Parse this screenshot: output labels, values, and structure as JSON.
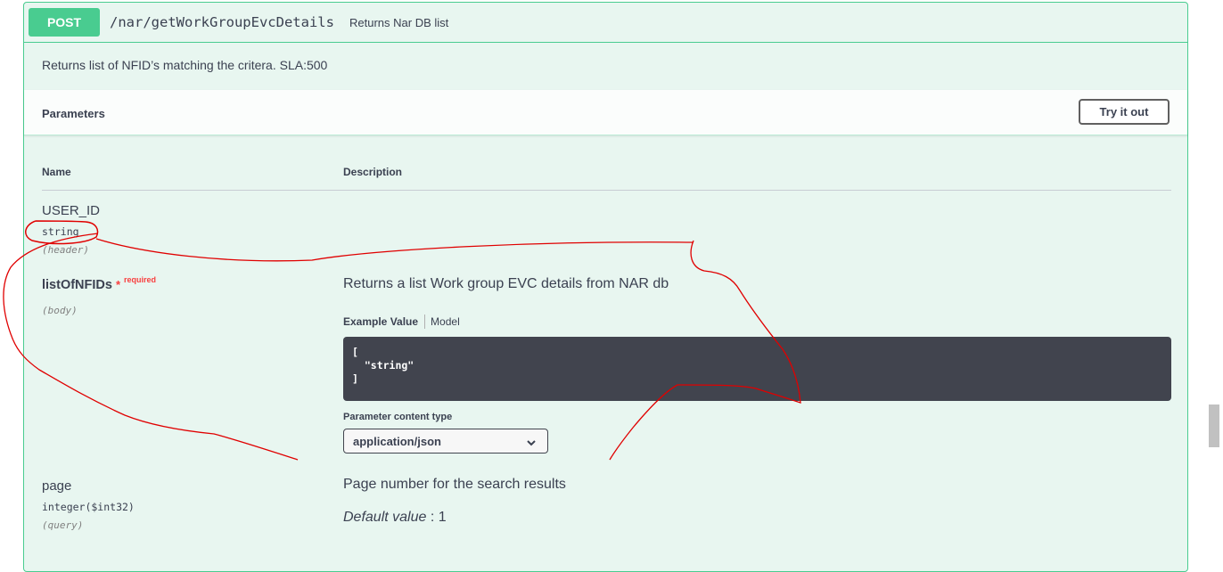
{
  "operation": {
    "method": "POST",
    "path": "/nar/getWorkGroupEvcDetails",
    "summary": "Returns Nar DB list",
    "description": "Returns list of NFID’s matching the critera. SLA:500"
  },
  "parameters_section": {
    "title": "Parameters",
    "try_button_label": "Try it out",
    "columns": {
      "name": "Name",
      "description": "Description"
    }
  },
  "params": [
    {
      "name": "USER_ID",
      "type": "string",
      "in": "(header)",
      "description": ""
    },
    {
      "name": "listOfNFIDs",
      "required_star": "*",
      "required_label": "required",
      "in": "(body)",
      "description": "Returns a list Work group EVC details from NAR db",
      "tabs": {
        "active": "Example Value",
        "other": "Model"
      },
      "example_lines": [
        "[",
        "  \"string\"",
        "]"
      ],
      "content_type_label": "Parameter content type",
      "content_type_value": "application/json"
    },
    {
      "name": "page",
      "type": "integer($int32)",
      "in": "(query)",
      "description": "Page number for the search results",
      "default_label": "Default value",
      "default_sep": " : ",
      "default_value": "1"
    }
  ],
  "colors": {
    "post_green": "#49cc90",
    "panel_bg": "#e8f6f0",
    "code_bg": "#41444e",
    "required_red": "#f93e3e",
    "annotation_red": "#e00000"
  },
  "icons": {
    "select_chevron": "chevron-down-icon"
  }
}
